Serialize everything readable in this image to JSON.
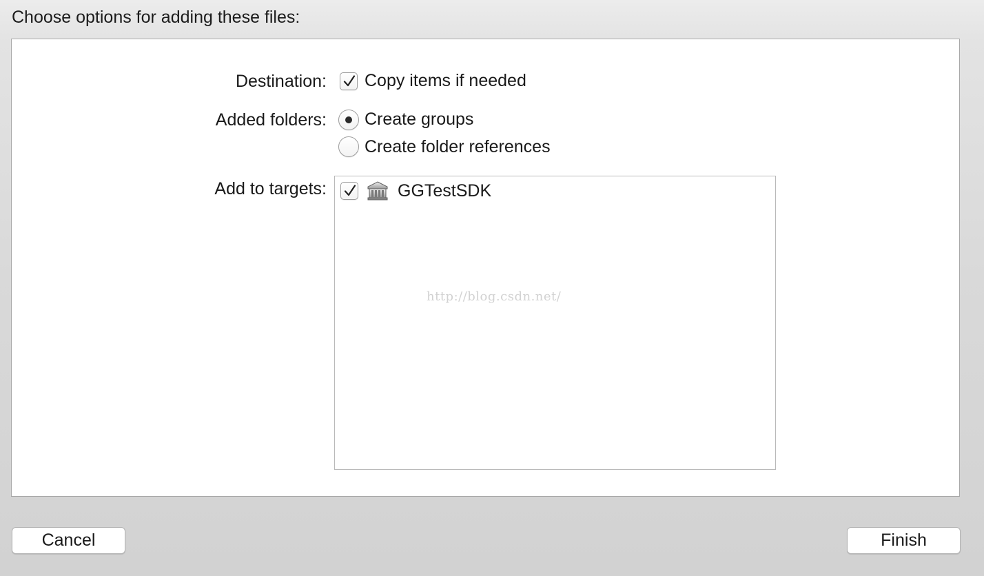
{
  "header": {
    "title": "Choose options for adding these files:"
  },
  "options": {
    "destination": {
      "label": "Destination:",
      "checkbox_label": "Copy items if needed",
      "checked": true
    },
    "added_folders": {
      "label": "Added folders:",
      "choices": [
        {
          "label": "Create groups",
          "selected": true
        },
        {
          "label": "Create folder references",
          "selected": false
        }
      ]
    },
    "targets": {
      "label": "Add to targets:",
      "items": [
        {
          "name": "GGTestSDK",
          "checked": true,
          "icon": "framework-target-icon"
        }
      ]
    }
  },
  "watermark": "http://blog.csdn.net/",
  "footer": {
    "cancel_label": "Cancel",
    "finish_label": "Finish"
  },
  "colors": {
    "panel_background": "#ffffff",
    "window_background": "#d9d9d9",
    "control_border": "#9d9d9d",
    "watermark_text": "#d2d2d2"
  }
}
